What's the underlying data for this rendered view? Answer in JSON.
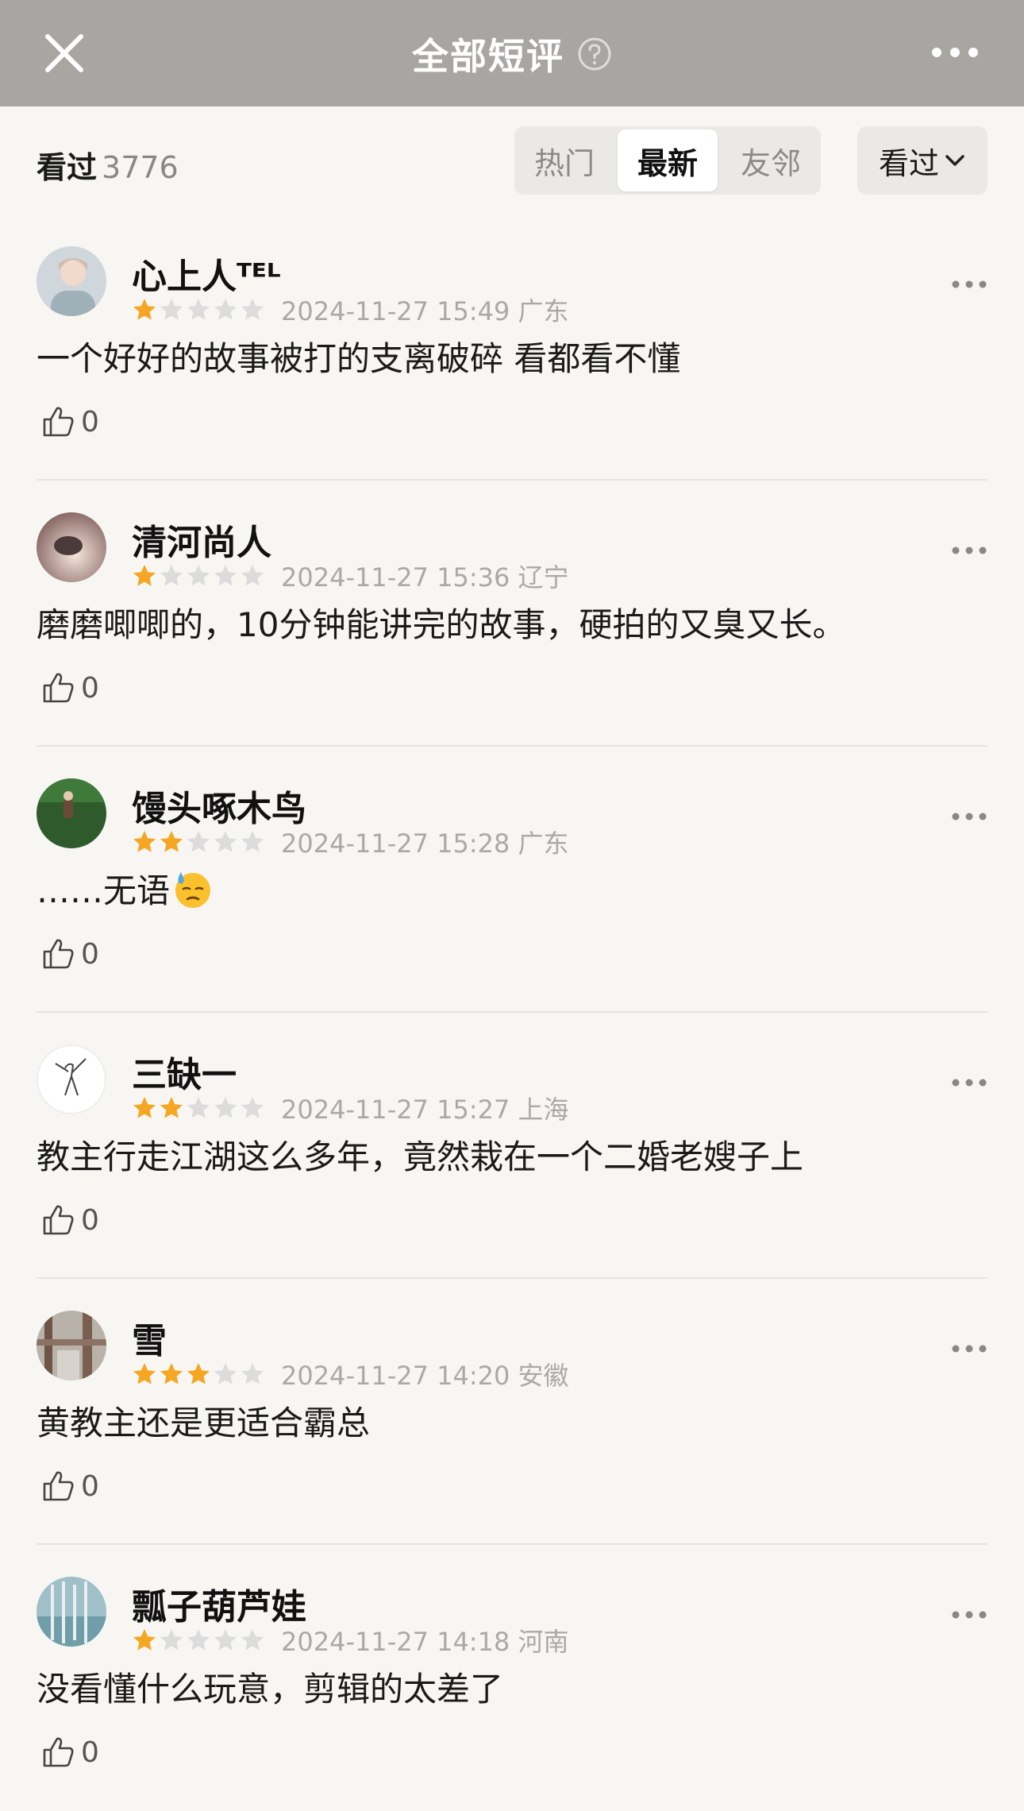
{
  "header": {
    "title": "全部短评"
  },
  "filter": {
    "watched_label": "看过",
    "watched_count": "3776",
    "tabs": [
      {
        "label": "热门",
        "active": false
      },
      {
        "label": "最新",
        "active": true
      },
      {
        "label": "友邻",
        "active": false
      }
    ],
    "dropdown_label": "看过"
  },
  "reviews": [
    {
      "name": "心上人ᵀᴱᴸ",
      "rating": 1,
      "meta": "2024-11-27 15:49 广东",
      "content": "一个好好的故事被打的支离破碎  看都看不懂",
      "likes": "0"
    },
    {
      "name": "清河尚人",
      "rating": 1,
      "meta": "2024-11-27 15:36 辽宁",
      "content": "磨磨唧唧的，10分钟能讲完的故事，硬拍的又臭又长。",
      "likes": "0"
    },
    {
      "name": "馒头啄木鸟",
      "rating": 2,
      "meta": "2024-11-27 15:28 广东",
      "content": "……无语",
      "likes": "0"
    },
    {
      "name": "三缺一",
      "rating": 2,
      "meta": "2024-11-27 15:27 上海",
      "content": "教主行走江湖这么多年，竟然栽在一个二婚老嫂子上",
      "likes": "0"
    },
    {
      "name": "雪",
      "rating": 3,
      "meta": "2024-11-27 14:20 安徽",
      "content": "黄教主还是更适合霸总",
      "likes": "0"
    },
    {
      "name": "瓢子葫芦娃",
      "rating": 1,
      "meta": "2024-11-27 14:18 河南",
      "content": "没看懂什么玩意，剪辑的太差了",
      "likes": "0"
    }
  ],
  "colors": {
    "header_bg": "#a8a6a3",
    "star_on": "#f5a623",
    "star_off": "#dcdcdc",
    "page_bg": "#f7f6f2"
  }
}
